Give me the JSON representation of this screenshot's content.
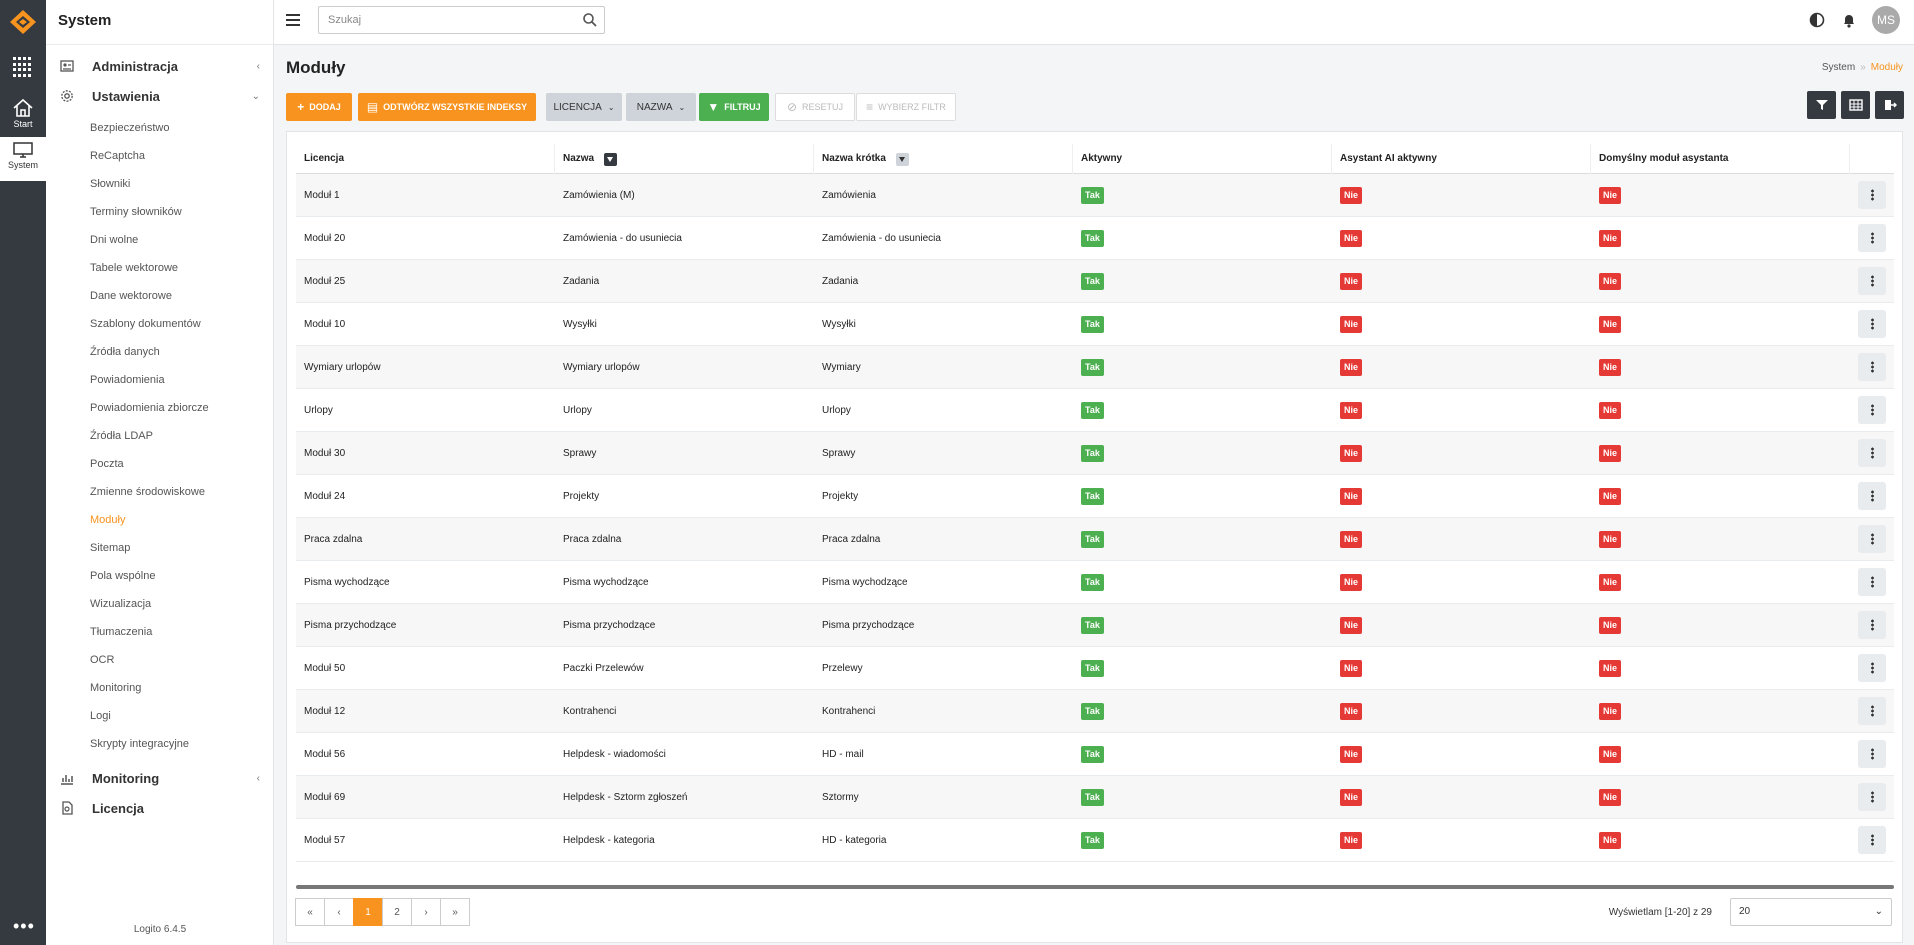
{
  "rail": {
    "items": [
      {
        "label": "Start",
        "icon": "home-icon"
      },
      {
        "label": "System",
        "icon": "monitor-icon"
      }
    ],
    "more": "•••"
  },
  "sidebar": {
    "title": "System",
    "top": [
      {
        "label": "Administracja",
        "icon": "admin-icon",
        "chev": "‹"
      },
      {
        "label": "Ustawienia",
        "icon": "gear-icon",
        "chev": "⌄"
      }
    ],
    "settings_items": [
      "Bezpieczeństwo",
      "ReCaptcha",
      "Słowniki",
      "Terminy słowników",
      "Dni wolne",
      "Tabele wektorowe",
      "Dane wektorowe",
      "Szablony dokumentów",
      "Źródła danych",
      "Powiadomienia",
      "Powiadomienia zbiorcze",
      "Źródła LDAP",
      "Poczta",
      "Zmienne środowiskowe",
      "Moduły",
      "Sitemap",
      "Pola wspólne",
      "Wizualizacja",
      "Tłumaczenia",
      "OCR",
      "Monitoring",
      "Logi",
      "Skrypty integracyjne"
    ],
    "active_item": "Moduły",
    "bottom": [
      {
        "label": "Monitoring",
        "icon": "chart-icon",
        "chev": "‹"
      },
      {
        "label": "Licencja",
        "icon": "license-icon",
        "chev": ""
      }
    ],
    "version": "Logito 6.4.5"
  },
  "topbar": {
    "search_placeholder": "Szukaj",
    "avatar": "MS"
  },
  "page": {
    "title": "Moduły",
    "breadcrumb": {
      "root": "System",
      "sep": "»",
      "current": "Moduły"
    }
  },
  "toolbar": {
    "add": "DODAJ",
    "rebuild": "ODTWÓRZ WSZYSTKIE INDEKSY",
    "license": "LICENCJA",
    "name": "NAZWA",
    "filter": "FILTRUJ",
    "reset": "RESETUJ",
    "choose_filter": "WYBIERZ FILTR"
  },
  "table": {
    "columns": [
      "Licencja",
      "Nazwa",
      "Nazwa krótka",
      "Aktywny",
      "Asystant AI aktywny",
      "Domyślny moduł asystanta"
    ],
    "rows": [
      [
        "Moduł 1",
        "Zamówienia (M)",
        "Zamówienia",
        "Tak",
        "Nie",
        "Nie"
      ],
      [
        "Moduł 20",
        "Zamówienia - do usuniecia",
        "Zamówienia - do usuniecia",
        "Tak",
        "Nie",
        "Nie"
      ],
      [
        "Moduł 25",
        "Zadania",
        "Zadania",
        "Tak",
        "Nie",
        "Nie"
      ],
      [
        "Moduł 10",
        "Wysyłki",
        "Wysyłki",
        "Tak",
        "Nie",
        "Nie"
      ],
      [
        "Wymiary urlopów",
        "Wymiary urlopów",
        "Wymiary",
        "Tak",
        "Nie",
        "Nie"
      ],
      [
        "Urlopy",
        "Urlopy",
        "Urlopy",
        "Tak",
        "Nie",
        "Nie"
      ],
      [
        "Moduł 30",
        "Sprawy",
        "Sprawy",
        "Tak",
        "Nie",
        "Nie"
      ],
      [
        "Moduł 24",
        "Projekty",
        "Projekty",
        "Tak",
        "Nie",
        "Nie"
      ],
      [
        "Praca zdalna",
        "Praca zdalna",
        "Praca zdalna",
        "Tak",
        "Nie",
        "Nie"
      ],
      [
        "Pisma wychodzące",
        "Pisma wychodzące",
        "Pisma wychodzące",
        "Tak",
        "Nie",
        "Nie"
      ],
      [
        "Pisma przychodzące",
        "Pisma przychodzące",
        "Pisma przychodzące",
        "Tak",
        "Nie",
        "Nie"
      ],
      [
        "Moduł 50",
        "Paczki Przelewów",
        "Przelewy",
        "Tak",
        "Nie",
        "Nie"
      ],
      [
        "Moduł 12",
        "Kontrahenci",
        "Kontrahenci",
        "Tak",
        "Nie",
        "Nie"
      ],
      [
        "Moduł 56",
        "Helpdesk - wiadomości",
        "HD - mail",
        "Tak",
        "Nie",
        "Nie"
      ],
      [
        "Moduł 69",
        "Helpdesk - Sztorm zgłoszeń",
        "Sztormy",
        "Tak",
        "Nie",
        "Nie"
      ],
      [
        "Moduł 57",
        "Helpdesk - kategoria",
        "HD - kategoria",
        "Tak",
        "Nie",
        "Nie"
      ]
    ]
  },
  "pagination": {
    "pages": [
      "1",
      "2"
    ],
    "current": "1",
    "info": "Wyświetlam [1-20] z 29",
    "page_size": "20"
  },
  "colors": {
    "accent": "#f7931e",
    "success": "#4caf50",
    "danger": "#e53935",
    "dark": "#343a40"
  }
}
